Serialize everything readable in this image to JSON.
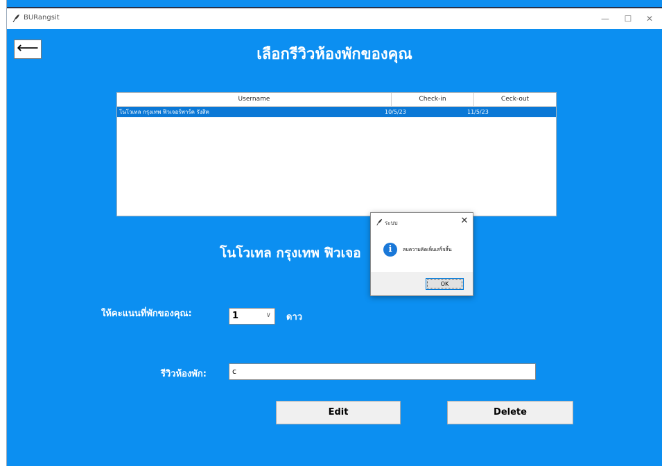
{
  "window": {
    "title": "BURangsit",
    "minimize_symbol": "—",
    "maximize_symbol": "☐",
    "close_symbol": "✕"
  },
  "back_button": {
    "symbol": "⟵"
  },
  "heading": "เลือกรีวิวห้องพักของคุณ",
  "table": {
    "columns": [
      "Username",
      "Check-in",
      "Ceck-out"
    ],
    "rows": [
      {
        "username": "โนโวเทล กรุงเทพ ฟิวเจอร์พาร์ค รังสิต",
        "check_in": "10/5/23",
        "check_out": "11/5/23",
        "selected": true
      }
    ]
  },
  "hotel_name": "โนโวเทล กรุงเทพ ฟิวเจอ",
  "rating": {
    "label": "ให้คะแนนที่พักของคุณ:",
    "selected_value": "1",
    "unit_label": "ดาว"
  },
  "review": {
    "label": "รีวิวห้องพัก:",
    "value": "c"
  },
  "buttons": {
    "edit": "Edit",
    "delete": "Delete"
  },
  "dialog": {
    "title": "ระบบ",
    "message": "ลบความคิดเห็นเสร็จสิ้น",
    "ok_label": "OK",
    "icon": "info-icon",
    "close_symbol": "✕"
  },
  "colors": {
    "background": "#0c8ff1",
    "selected_row": "#0a78d6",
    "info_icon": "#1a78d8"
  }
}
